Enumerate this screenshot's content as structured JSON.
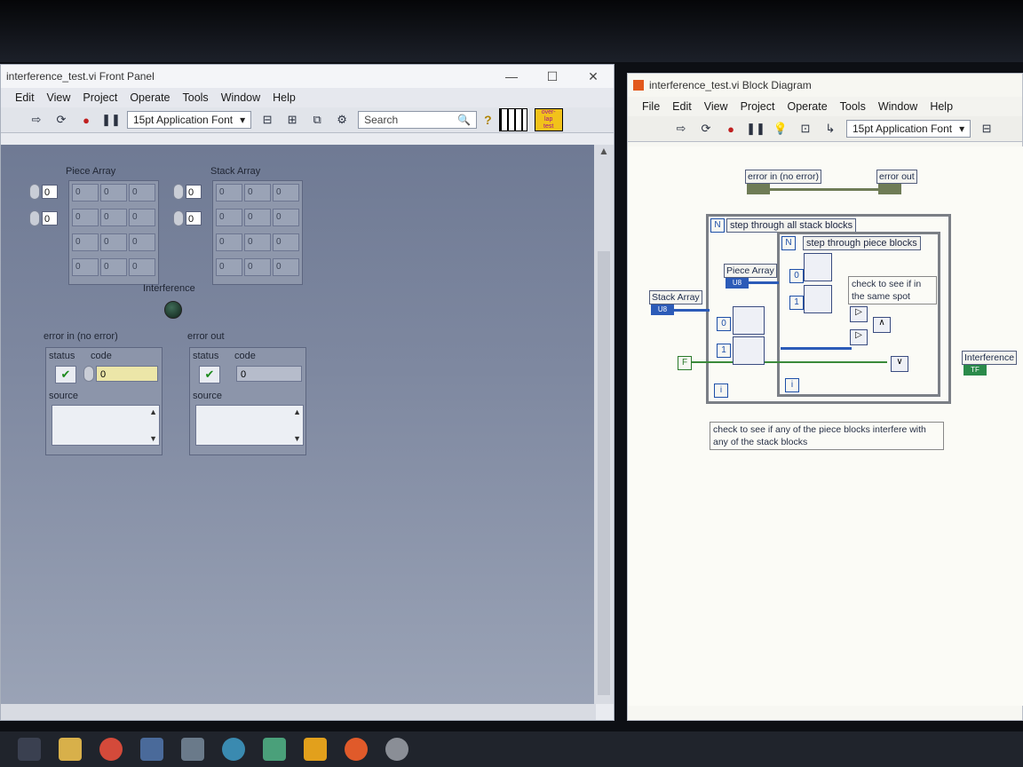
{
  "front_panel": {
    "title": "interference_test.vi Front Panel",
    "window_controls": {
      "minimize": "—",
      "maximize": "☐",
      "close": "✕"
    },
    "menu": [
      "Edit",
      "View",
      "Project",
      "Operate",
      "Tools",
      "Window",
      "Help"
    ],
    "toolbar": {
      "font": "15pt Application Font",
      "search_placeholder": "Search",
      "help": "?",
      "icon_text": "over-\nlap\ntest"
    },
    "piece_array": {
      "label": "Piece Array",
      "index": [
        "0",
        "0"
      ],
      "cells": [
        [
          "0",
          "0",
          "0"
        ],
        [
          "0",
          "0",
          "0"
        ],
        [
          "0",
          "0",
          "0"
        ],
        [
          "0",
          "0",
          "0"
        ]
      ]
    },
    "stack_array": {
      "label": "Stack Array",
      "index": [
        "0",
        "0"
      ],
      "cells": [
        [
          "0",
          "0",
          "0"
        ],
        [
          "0",
          "0",
          "0"
        ],
        [
          "0",
          "0",
          "0"
        ],
        [
          "0",
          "0",
          "0"
        ]
      ]
    },
    "interference": {
      "label": "Interference"
    },
    "error_in": {
      "label": "error in (no error)",
      "status": "status",
      "code_label": "code",
      "code": "0",
      "source": "source"
    },
    "error_out": {
      "label": "error out",
      "status": "status",
      "code_label": "code",
      "code": "0",
      "source": "source"
    }
  },
  "block_diagram": {
    "title": "interference_test.vi Block Diagram",
    "menu": [
      "File",
      "Edit",
      "View",
      "Project",
      "Operate",
      "Tools",
      "Window",
      "Help"
    ],
    "toolbar": {
      "font": "15pt Application Font"
    },
    "terminals": {
      "error_in": "error in (no error)",
      "error_out": "error out",
      "piece_array": "Piece Array",
      "stack_array": "Stack Array",
      "interference": "Interference",
      "u8": "U8",
      "tf": "TF",
      "f": "F"
    },
    "outer_loop_label": "step through all stack blocks",
    "inner_loop_label": "step through piece blocks",
    "loop_n": "N",
    "loop_i": "i",
    "const_0": "0",
    "const_1": "1",
    "inner_comment": "check to see if in the same spot",
    "comment": "check to see if any of the piece blocks interfere with any of the stack blocks"
  }
}
